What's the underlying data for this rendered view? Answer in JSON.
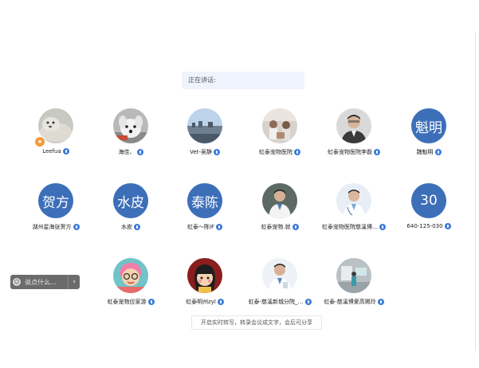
{
  "speaking_label": "正在讲话:",
  "participants": [
    {
      "name": "Leefua",
      "avatar_type": "photo",
      "icon": "seal-photo",
      "host": true
    },
    {
      "name": "海佳、",
      "avatar_type": "photo",
      "icon": "dog-photo"
    },
    {
      "name": "Vet-吴静",
      "avatar_type": "photo",
      "icon": "landscape-photo"
    },
    {
      "name": "虹泰宠物医院",
      "avatar_type": "photo",
      "icon": "clinic-photo"
    },
    {
      "name": "虹泰宠物医院李磊",
      "avatar_type": "photo",
      "icon": "man-photo"
    },
    {
      "name": "魏魁明",
      "avatar_type": "text",
      "avatar_text": "魁明"
    },
    {
      "name": "湖州星海张贺方",
      "avatar_type": "text",
      "avatar_text": "贺方"
    },
    {
      "name": "水皮",
      "avatar_type": "text",
      "avatar_text": "水皮"
    },
    {
      "name": "虹泰～陈IF",
      "avatar_type": "text",
      "avatar_text": "泰陈"
    },
    {
      "name": "虹泰宠物.就",
      "avatar_type": "photo",
      "icon": "doctor-photo"
    },
    {
      "name": "虹泰宠物医院慈溪博…",
      "avatar_type": "photo",
      "icon": "doctor-photo-2"
    },
    {
      "name": "640-125-030",
      "avatar_type": "text",
      "avatar_text": "30"
    },
    {
      "name": "虹泰宠物应家游",
      "avatar_type": "photo",
      "icon": "cartoon-photo"
    },
    {
      "name": "虹泰明州zyl",
      "avatar_type": "photo",
      "icon": "cartoon-girl-photo"
    },
    {
      "name": "虹泰-慈溪新城分院_…",
      "avatar_type": "photo",
      "icon": "doctor-photo-3"
    },
    {
      "name": "虹泰-慈溪博爱高赐玲",
      "avatar_type": "photo",
      "icon": "room-photo"
    }
  ],
  "chat": {
    "placeholder": "说点什么...",
    "smile_icon": "smile-icon",
    "collapse_icon": "chevron-left-icon"
  },
  "caption_prompt": "开启实时转写，转录会议成文字，会后可分享",
  "colors": {
    "text_avatar_bg": "#3d6fb9",
    "mic_icon": "#3d7bd9",
    "speaking_bg": "#eef3fd",
    "host_badge": "#f29a3a"
  }
}
